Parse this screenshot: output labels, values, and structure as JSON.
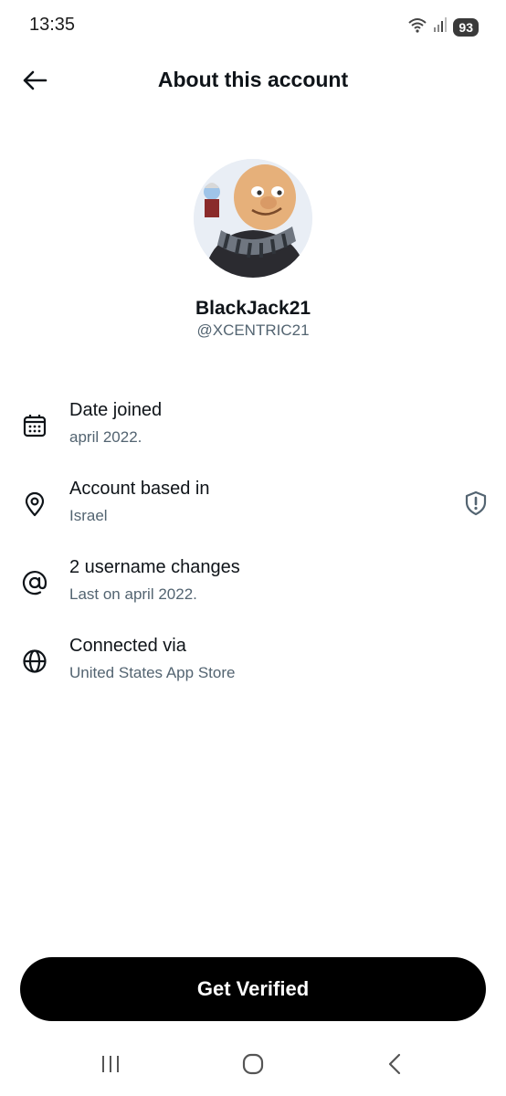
{
  "status_bar": {
    "time": "13:35",
    "battery": "93"
  },
  "header": {
    "title": "About this account",
    "back_icon": "arrow-left-icon"
  },
  "profile": {
    "display_name": "BlackJack21",
    "handle": "@XCENTRIC21"
  },
  "info_items": [
    {
      "icon": "calendar-icon",
      "title": "Date joined",
      "subtitle": "april 2022."
    },
    {
      "icon": "location-pin-icon",
      "title": "Account based in",
      "subtitle": "Israel",
      "right_icon": "shield-alert-icon"
    },
    {
      "icon": "at-sign-icon",
      "title": "2 username changes",
      "subtitle": "Last on april 2022."
    },
    {
      "icon": "globe-icon",
      "title": "Connected via",
      "subtitle": "United States App Store"
    }
  ],
  "cta": {
    "label": "Get Verified"
  },
  "colors": {
    "text_primary": "#0f1419",
    "text_secondary": "#536471",
    "button_bg": "#000000",
    "button_text": "#ffffff"
  }
}
